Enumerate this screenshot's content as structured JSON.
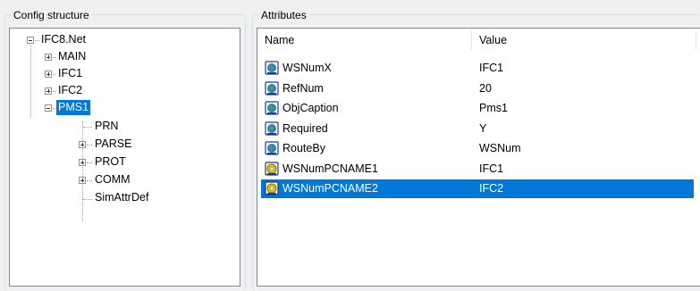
{
  "config_structure": {
    "title": "Config structure",
    "tree": {
      "root": "IFC8.Net",
      "level1": [
        {
          "label": "MAIN",
          "expander": "plus"
        },
        {
          "label": "IFC1",
          "expander": "plus"
        },
        {
          "label": "IFC2",
          "expander": "plus"
        },
        {
          "label": "PMS1",
          "expander": "minus",
          "selected": true
        }
      ],
      "pms1_children": [
        {
          "label": "PRN",
          "expander": "none"
        },
        {
          "label": "PARSE",
          "expander": "plus"
        },
        {
          "label": "PROT",
          "expander": "plus"
        },
        {
          "label": "COMM",
          "expander": "plus"
        },
        {
          "label": "SimAttrDef",
          "expander": "none"
        }
      ]
    }
  },
  "attributes": {
    "title": "Attributes",
    "columns": [
      "Name",
      "Value"
    ],
    "rows": [
      {
        "name": "WSNumX",
        "value": "IFC1",
        "icon": "globe-icon"
      },
      {
        "name": "RefNum",
        "value": "20",
        "icon": "globe-icon"
      },
      {
        "name": "ObjCaption",
        "value": "Pms1",
        "icon": "globe-icon"
      },
      {
        "name": "Required",
        "value": "Y",
        "icon": "globe-icon"
      },
      {
        "name": "RouteBy",
        "value": "WSNum",
        "icon": "globe-icon"
      },
      {
        "name": "WSNumPCNAME1",
        "value": "IFC1",
        "icon": "yellow-gear-icon"
      },
      {
        "name": "WSNumPCNAME2",
        "value": "IFC2",
        "icon": "yellow-gear-icon",
        "selected": true
      }
    ]
  },
  "colors": {
    "selection": "#0078d7",
    "window_bg": "#f0f0f0",
    "panel_border": "#828790"
  }
}
